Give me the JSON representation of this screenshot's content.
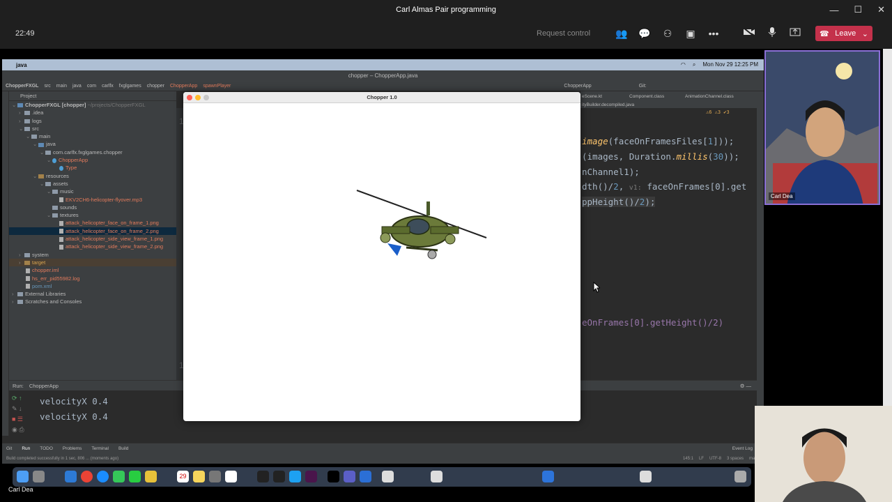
{
  "teams": {
    "title": "Carl Almas Pair programming",
    "time": "22:49",
    "request_control": "Request control",
    "leave_label": "Leave"
  },
  "mac": {
    "app_name": "java",
    "datetime": "Mon Nov 29  12:25 PM"
  },
  "ide": {
    "window_title": "chopper – ChopperApp.java",
    "breadcrumb": [
      "ChopperFXGL",
      "src",
      "main",
      "java",
      "com",
      "carlfx",
      "fxglgames",
      "chopper"
    ],
    "breadcrumb_class": "ChopperApp",
    "breadcrumb_method": "spawnPlayer",
    "run_config": "ChopperApp",
    "git_label": "Git:",
    "project_title": "Project",
    "tree": [
      {
        "label": "ChopperFXGL [chopper]",
        "hint": "~/projects/ChopperFXGL"
      },
      {
        "label": ".idea"
      },
      {
        "label": "logs"
      },
      {
        "label": "src"
      },
      {
        "label": "main"
      },
      {
        "label": "java"
      },
      {
        "label": "com.carlfx.fxglgames.chopper"
      },
      {
        "label": "ChopperApp"
      },
      {
        "label": "Type"
      },
      {
        "label": "resources"
      },
      {
        "label": "assets"
      },
      {
        "label": "music"
      },
      {
        "label": "EKV2CH6-helicopter-flyover.mp3"
      },
      {
        "label": "sounds"
      },
      {
        "label": "textures"
      },
      {
        "label": "attack_helicopter_face_on_frame_1.png"
      },
      {
        "label": "attack_helicopter_face_on_frame_2.png"
      },
      {
        "label": "attack_helicopter_side_view_frame_1.png"
      },
      {
        "label": "attack_helicopter_side_view_frame_2.png"
      },
      {
        "label": "system"
      },
      {
        "label": "target"
      },
      {
        "label": "chopper.iml"
      },
      {
        "label": "hs_err_pid55982.log"
      },
      {
        "label": "pom.xml"
      },
      {
        "label": "External Libraries"
      },
      {
        "label": "Scratches and Consoles"
      }
    ],
    "editor_tabs": [
      "eScene.kt",
      "Component.class",
      "AnimationChannel.class",
      "ityBuilder.decompiled.java"
    ],
    "inspections": "⚠6  ⚠3  ✔3",
    "code_lines": [
      {
        "t1": "image",
        "t2": "(faceOnFramesFiles[",
        "n": "1",
        "t3": "]));"
      },
      {
        "t1": "(images, Duration.",
        "t2": "millis",
        "n": "30",
        "t3": "));"
      },
      {
        "t1": "nChannel1);"
      },
      {
        "t1": "dth()/",
        "n": "2",
        "hint": "v1:",
        "t3": " faceOnFrames[0].get"
      },
      {
        "t1": "ppHeight()/",
        "n": "2",
        "t3": ");"
      },
      {
        "t1": "eOnFrames[0].getHeight()/2)"
      }
    ],
    "run_label": "Run:",
    "run_tab": "ChopperApp",
    "console_lines": [
      "velocityX 0.4",
      "velocityX 0.4"
    ],
    "tool_tabs": [
      "Git",
      "Run",
      "TODO",
      "Problems",
      "Terminal",
      "Build"
    ],
    "event_log": "Event Log",
    "status_text": "Build completed successfully in 1 sec, 806 ... (moments ago)",
    "status_right": [
      "145:1",
      "LF",
      "UTF-8",
      "3 spaces",
      "main"
    ],
    "gutter_numbers": [
      "1",
      "1",
      "1",
      "1",
      "1",
      "1",
      "1",
      "1",
      "1",
      "1",
      "1",
      "1",
      "1",
      "1",
      "1",
      "1",
      "1"
    ]
  },
  "fx": {
    "title": "Chopper 1.0"
  },
  "presenter_caption": "Carl Dea",
  "participants": [
    {
      "name": "Carl Dea"
    }
  ]
}
